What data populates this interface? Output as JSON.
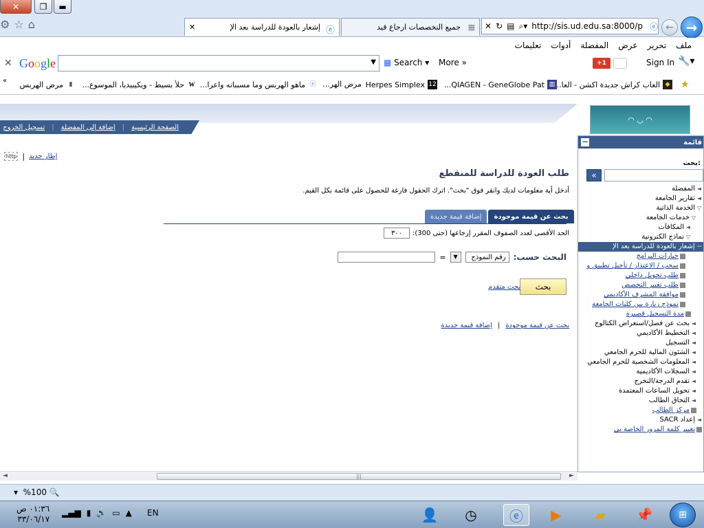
{
  "browser": {
    "tabs": [
      {
        "title": "جميع التخصصات ارجاع قيد"
      },
      {
        "title": "إشعار بالعودة للدراسة بعد الإ"
      }
    ],
    "address": "http://sis.ud.edu.sa:8000/p",
    "menu": [
      "ملف",
      "تحرير",
      "عرض",
      "المفضلة",
      "أدوات",
      "تعليمات"
    ]
  },
  "google_toolbar": {
    "logo": "Google",
    "search_label": "Search",
    "more_label": "More",
    "plus_label": "+1",
    "signin_label": "Sign In"
  },
  "favorites": [
    {
      "label": "العاب كراش جديدة اكشن - العا..."
    },
    {
      "label": "QIAGEN - GeneGlobe Pat..."
    },
    {
      "label": "Herpes Simplex"
    },
    {
      "label": "مرض الهر..."
    },
    {
      "label": "ماهو الهربس وما مسبباته واعرا..."
    },
    {
      "label": "حلأ بسيط - ويكيبيديا، الموسوع..."
    },
    {
      "label": "مرض الهربس"
    }
  ],
  "page": {
    "nav_links": [
      "الصفحة الرئيسية",
      "إضافة إلى المفضلة",
      "تسجيل الخروج"
    ],
    "new_window": "إطار جديد",
    "http_label": "http",
    "title": "طلب العودة للدراسة للمنقطع",
    "hint": "أدخل أية معلومات لديك وانقر فوق \"بحث\". اترك الحقول فارغة للحصول على قائمة بكل القيم.",
    "tab_find": "بحث عن قيمة موجودة",
    "tab_add": "إضافة قيمة جديدة",
    "max_rows_label": "الحد الأقصى لعدد الصفوف المقرر إرجاعها (حتى 300):",
    "max_rows_value": "٣٠٠",
    "search_by_label": "البحث حسب:",
    "search_field": "رقم النموذج",
    "search_operator": "=",
    "search_button": "بحث",
    "advanced_search": "بحث متقدم",
    "bottom_find": "بحث عن قيمة موجودة",
    "bottom_add": "إضافة قيمة جديدة"
  },
  "sidebar": {
    "title": "قائمة",
    "search_label": "بحث:",
    "items": [
      {
        "label": "المفضلة",
        "marker": "◄",
        "indent": 0,
        "link": false
      },
      {
        "label": "تقارير الجامعة",
        "marker": "◄",
        "indent": 0,
        "link": false
      },
      {
        "label": "الخدمة الذاتية",
        "marker": "▽",
        "indent": 0,
        "link": false
      },
      {
        "label": "خدمات الجامعة",
        "marker": "▽",
        "indent": 1,
        "link": false
      },
      {
        "label": "المكافآت",
        "marker": "◄",
        "indent": 2,
        "link": false
      },
      {
        "label": "نماذج الكترونية",
        "marker": "▽",
        "indent": 2,
        "link": false
      },
      {
        "label": "-- إشعار بالعودة للدراسة بعد الإ",
        "marker": "",
        "indent": 0,
        "link": false,
        "selected": true
      },
      {
        "label": "خيارات البرامج",
        "marker": "sq",
        "indent": 3,
        "link": true
      },
      {
        "label": "سحب / الاعتذار / تأجيل تطبيق و",
        "marker": "sq",
        "indent": 3,
        "link": true
      },
      {
        "label": "طلب تحويل داخلي",
        "marker": "sq",
        "indent": 3,
        "link": true
      },
      {
        "label": "طلب تغيير التخصص",
        "marker": "sq",
        "indent": 3,
        "link": true
      },
      {
        "label": "موافقة المشرف الأكاديمي",
        "marker": "sq",
        "indent": 3,
        "link": true
      },
      {
        "label": "نموذج زيارة بين كليات الجامعة",
        "marker": "sq",
        "indent": 3,
        "link": true
      },
      {
        "label": "مدة التسجيل قصيرة",
        "marker": "sq",
        "indent": 2,
        "link": true
      },
      {
        "label": "بحث عن فصل/استعراض الكتالوج",
        "marker": "◄",
        "indent": 1,
        "link": false
      },
      {
        "label": "التخطيط الأكاديمي",
        "marker": "◄",
        "indent": 1,
        "link": false
      },
      {
        "label": "التسجيل",
        "marker": "◄",
        "indent": 1,
        "link": false
      },
      {
        "label": "الشئون المالية للحرم الجامعي",
        "marker": "◄",
        "indent": 1,
        "link": false
      },
      {
        "label": "المعلومات الشخصية للحرم الجامعي",
        "marker": "◄",
        "indent": 1,
        "link": false
      },
      {
        "label": "السجلات الأكاديمية",
        "marker": "◄",
        "indent": 1,
        "link": false
      },
      {
        "label": "تقدم الدرجة/التخرج",
        "marker": "◄",
        "indent": 1,
        "link": false
      },
      {
        "label": "تحويل الساعات المعتمدة",
        "marker": "◄",
        "indent": 1,
        "link": false
      },
      {
        "label": "التحاق الطالب",
        "marker": "◄",
        "indent": 1,
        "link": false
      },
      {
        "label": "مركز الطالب",
        "marker": "sq",
        "indent": 1,
        "link": true
      },
      {
        "label": "إعداد SACR",
        "marker": "◄",
        "indent": 0,
        "link": false
      },
      {
        "label": "تغيير كلمة المرور الخاصة بي",
        "marker": "sq",
        "indent": 0,
        "link": true
      }
    ]
  },
  "status": {
    "zoom": "%100"
  },
  "taskbar": {
    "time": "٠١:٣٦ ص",
    "date": "٣٣/٠٦/١٧",
    "lang": "EN"
  }
}
